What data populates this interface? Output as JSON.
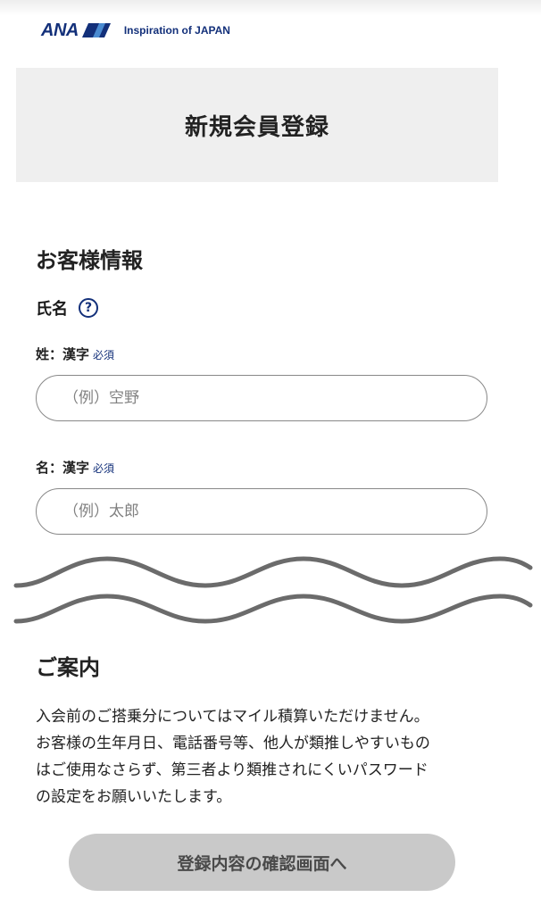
{
  "header": {
    "logo_text": "ANA",
    "tagline": "Inspiration of JAPAN"
  },
  "page_title": "新規会員登録",
  "customer_info": {
    "heading": "お客様情報",
    "name_section": {
      "label": "氏名",
      "help_icon_glyph": "?"
    },
    "fields": [
      {
        "label": "姓：漢字",
        "required": "必須",
        "placeholder": "（例）空野",
        "value": ""
      },
      {
        "label": "名：漢字",
        "required": "必須",
        "placeholder": "（例）太郎",
        "value": ""
      }
    ]
  },
  "notice": {
    "heading": "ご案内",
    "lines": [
      "入会前のご搭乗分についてはマイル積算いただけません。",
      "お客様の生年月日、電話番号等、他人が類推しやすいもの",
      "はご使用なさらず、第三者より類推されにくいパスワード",
      "の設定をお願いいたします。"
    ]
  },
  "cta": {
    "label": "登録内容の確認画面へ"
  },
  "colors": {
    "brand": "#13307a",
    "band_bg": "#efefef",
    "button_disabled_bg": "#c9c9c9",
    "wave": "#6b6b6b"
  },
  "icons": [
    "ana-logo-icon",
    "help-icon",
    "wave-divider"
  ]
}
